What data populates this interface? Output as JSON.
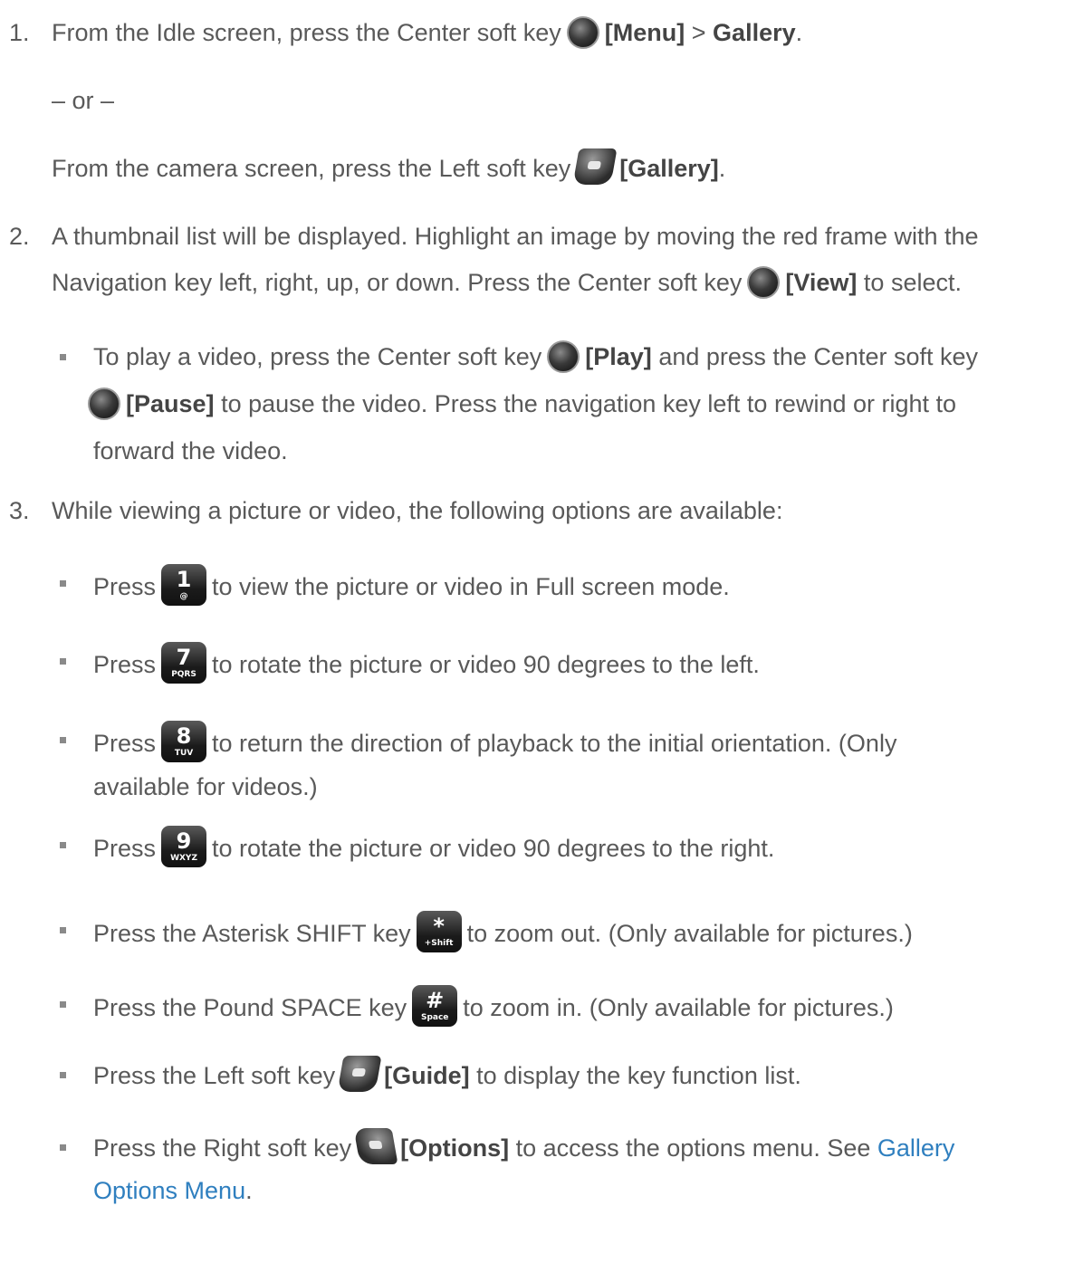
{
  "step1": {
    "num": "1.",
    "a": "From the Idle screen, press the Center soft key",
    "b": "[Menu]",
    "c": ">",
    "d": "Gallery",
    "e": ".",
    "or": "– or –",
    "f": "From the camera screen, press the Left soft key",
    "g": "[Gallery]",
    "h": "."
  },
  "step2": {
    "num": "2.",
    "l1": "A thumbnail list will be displayed. Highlight an image by moving the red frame with the",
    "l2a": "Navigation key left, right, up, or down. Press the Center soft key",
    "l2b": "[View]",
    "l2c": "to select.",
    "bullet": {
      "a": "To play a video, press the Center soft key",
      "b": "[Play]",
      "c": "and press the Center soft key",
      "d": "[Pause]",
      "e": "to pause the video. Press the navigation key left to rewind or right to",
      "f": "forward the video."
    }
  },
  "step3": {
    "num": "3.",
    "intro": "While viewing a picture or video, the following options are available:",
    "press": "Press",
    "i1": "to view the picture or video in Full screen mode.",
    "i2": "to rotate the picture or video 90 degrees to the left.",
    "i3a": "to return the direction of playback to the initial orientation. (Only",
    "i3b": "available for videos.)",
    "i4": "to rotate the picture or video 90 degrees to the right.",
    "i5a": "Press the Asterisk SHIFT key",
    "i5b": "to zoom out. (Only available for pictures.)",
    "i6a": "Press the Pound SPACE key",
    "i6b": "to zoom in. (Only available for pictures.)",
    "i7a": "Press the Left soft key",
    "i7b": "[Guide]",
    "i7c": "to display the key function list.",
    "i8a": "Press the Right soft key",
    "i8b": "[Options]",
    "i8c": "to access the options menu. See",
    "i8link1": "Gallery",
    "i8link2": "Options Menu",
    "i8d": "."
  },
  "keys": {
    "k1": {
      "big": "1",
      "sm": "@"
    },
    "k7": {
      "big": "7",
      "sm": "PQRS"
    },
    "k8": {
      "big": "8",
      "sm": "TUV"
    },
    "k9": {
      "big": "9",
      "sm": "WXYZ"
    },
    "kstar": {
      "big": "*",
      "sm": "+Shift"
    },
    "kpound": {
      "big": "#",
      "sm": "Space"
    }
  }
}
